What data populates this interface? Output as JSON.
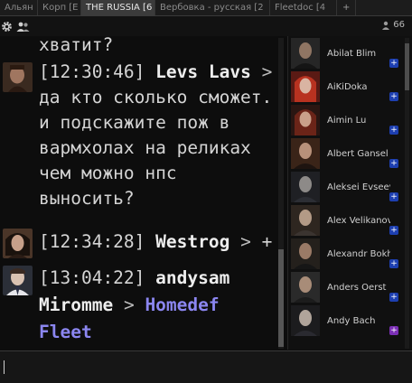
{
  "tabs": [
    {
      "label": "Альян",
      "active": false
    },
    {
      "label": "Корп [E",
      "active": false
    },
    {
      "label": "THE RUSSIA [6",
      "active": true
    },
    {
      "label": "Вербовка - русская [2",
      "active": false
    },
    {
      "label": "Fleetdoc [4",
      "active": false
    }
  ],
  "tab_add_label": "+",
  "toolbar": {
    "gear_icon": "gear-icon",
    "people_icon": "people-icon",
    "member_count": "66"
  },
  "messages": {
    "m0": {
      "line1": "хватит?"
    },
    "m1": {
      "timestamp": "[12:30:46]",
      "sender": "Levs Lavs",
      "arrow": ">",
      "line2": "да кто сколько сможет.",
      "line3": "и подскажите пож в",
      "line4": "вармхолах на реликах",
      "line5": "чем можно нпс",
      "line6": "выносить?"
    },
    "m2": {
      "timestamp": "[12:34:28]",
      "sender": "Westrog",
      "arrow": ">",
      "tail": "+"
    },
    "m3": {
      "timestamp": "[13:04:22]",
      "sender_first": "andysam",
      "sender_second": "Miromme",
      "arrow": ">",
      "link1": "Homedef",
      "link2": "Fleet"
    }
  },
  "members": [
    {
      "name": "Abilat Blim",
      "badge": "+",
      "badge_color": "#1d3fb0"
    },
    {
      "name": "AiKiDoka",
      "badge": "+",
      "badge_color": "#1d3fb0"
    },
    {
      "name": "Aimin Lu",
      "badge": "+",
      "badge_color": "#1d3fb0"
    },
    {
      "name": "Albert Gansel",
      "badge": "+",
      "badge_color": "#1d3fb0"
    },
    {
      "name": "Aleksei Evseev",
      "badge": "+",
      "badge_color": "#1d3fb0"
    },
    {
      "name": "Alex Velikanov",
      "badge": "+",
      "badge_color": "#1d3fb0"
    },
    {
      "name": "Alexandr Bokhan",
      "badge": "+",
      "badge_color": "#1d3fb0"
    },
    {
      "name": "Anders Oerst",
      "badge": "+",
      "badge_color": "#1d3fb0"
    },
    {
      "name": "Andy Bach",
      "badge": "+",
      "badge_color": "#7b2fb5"
    }
  ],
  "input": {
    "value": "",
    "placeholder": ""
  }
}
